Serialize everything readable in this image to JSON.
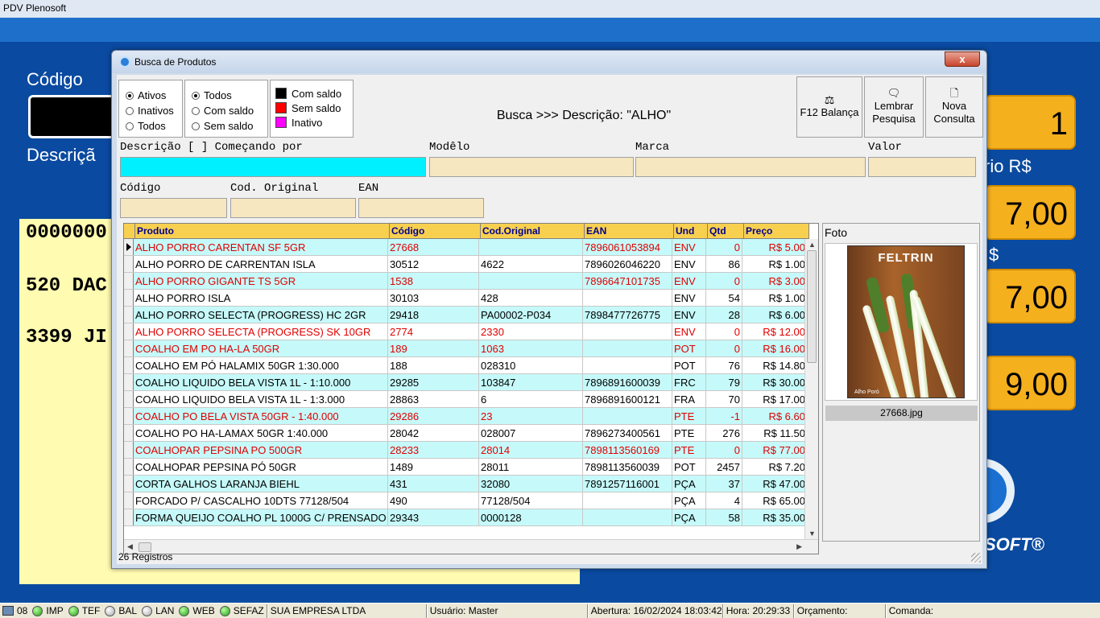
{
  "app": {
    "title": "PDV Plenosoft",
    "bg_codigo_label": "Código",
    "bg_descricao_label": "Descriçã",
    "bg_lines": [
      "0000000",
      "520 DAC",
      "3399 JI"
    ],
    "bg_qty": "1",
    "bg_unit_label": "rio R$",
    "bg_value1": "7,00",
    "bg_currency": "$",
    "bg_value2": "7,00",
    "bg_total": "9,00",
    "bg_logo_text": "SOFT®"
  },
  "dialog": {
    "title": "Busca de Produtos",
    "close_label": "x",
    "status_group": [
      "Ativos",
      "Inativos",
      "Todos"
    ],
    "status_selected": 0,
    "stock_group": [
      "Todos",
      "Com saldo",
      "Sem saldo"
    ],
    "stock_selected": 0,
    "legend": [
      {
        "label": "Com saldo",
        "color": "#000000"
      },
      {
        "label": "Sem saldo",
        "color": "#ff0000"
      },
      {
        "label": "Inativo",
        "color": "#ff00ff"
      }
    ],
    "search_caption": "Busca >>> Descrição: \"ALHO\"",
    "buttons": {
      "balanca": "F12 Balança",
      "lembrar_1": "Lembrar",
      "lembrar_2": "Pesquisa",
      "nova_1": "Nova",
      "nova_2": "Consulta"
    },
    "fields": {
      "descricao_label": "Descrição [ ] Começando por",
      "modelo_label": "Modêlo",
      "marca_label": "Marca",
      "valor_label": "Valor",
      "codigo_label": "Código",
      "cod_original_label": "Cod. Original",
      "ean_label": "EAN"
    },
    "grid": {
      "columns": [
        "Produto",
        "Código",
        "Cod.Original",
        "EAN",
        "Und",
        "Qtd",
        "Preço"
      ],
      "rows": [
        {
          "produto": "ALHO PORRO CARENTAN SF 5GR",
          "codigo": "27668",
          "cod_original": "",
          "ean": "7896061053894",
          "und": "ENV",
          "qtd": "0",
          "preco": "R$ 5.00",
          "red": true
        },
        {
          "produto": "ALHO PORRO DE CARRENTAN ISLA",
          "codigo": "30512",
          "cod_original": "4622",
          "ean": "7896026046220",
          "und": "ENV",
          "qtd": "86",
          "preco": "R$ 1.00",
          "red": false
        },
        {
          "produto": "ALHO PORRO GIGANTE TS 5GR",
          "codigo": "1538",
          "cod_original": "",
          "ean": "7896647101735",
          "und": "ENV",
          "qtd": "0",
          "preco": "R$ 3.00",
          "red": true
        },
        {
          "produto": "ALHO PORRO ISLA",
          "codigo": "30103",
          "cod_original": "428",
          "ean": "",
          "und": "ENV",
          "qtd": "54",
          "preco": "R$ 1.00",
          "red": false
        },
        {
          "produto": "ALHO PORRO SELECTA (PROGRESS) HC 2GR",
          "codigo": "29418",
          "cod_original": "PA00002-P034",
          "ean": "7898477726775",
          "und": "ENV",
          "qtd": "28",
          "preco": "R$ 6.00",
          "red": false
        },
        {
          "produto": "ALHO PORRO SELECTA (PROGRESS) SK 10GR",
          "codigo": "2774",
          "cod_original": "2330",
          "ean": "",
          "und": "ENV",
          "qtd": "0",
          "preco": "R$ 12.00",
          "red": true
        },
        {
          "produto": "COALHO EM PO HA-LA 50GR",
          "codigo": "189",
          "cod_original": "1063",
          "ean": "",
          "und": "POT",
          "qtd": "0",
          "preco": "R$ 16.00",
          "red": true
        },
        {
          "produto": "COALHO EM PÓ HALAMIX 50GR 1:30.000",
          "codigo": "188",
          "cod_original": "028310",
          "ean": "",
          "und": "POT",
          "qtd": "76",
          "preco": "R$ 14.80",
          "red": false
        },
        {
          "produto": "COALHO LIQUIDO BELA VISTA 1L - 1:10.000",
          "codigo": "29285",
          "cod_original": "103847",
          "ean": "7896891600039",
          "und": "FRC",
          "qtd": "79",
          "preco": "R$ 30.00",
          "red": false
        },
        {
          "produto": "COALHO LIQUIDO BELA VISTA 1L - 1:3.000",
          "codigo": "28863",
          "cod_original": "6",
          "ean": "7896891600121",
          "und": "FRA",
          "qtd": "70",
          "preco": "R$ 17.00",
          "red": false
        },
        {
          "produto": "COALHO PO BELA VISTA 50GR - 1:40.000",
          "codigo": "29286",
          "cod_original": "23",
          "ean": "",
          "und": "PTE",
          "qtd": "-1",
          "preco": "R$ 6.60",
          "red": true
        },
        {
          "produto": "COALHO PO HA-LAMAX 50GR 1:40.000",
          "codigo": "28042",
          "cod_original": "028007",
          "ean": "7896273400561",
          "und": "PTE",
          "qtd": "276",
          "preco": "R$ 11.50",
          "red": false
        },
        {
          "produto": "COALHOPAR PEPSINA PO 500GR",
          "codigo": "28233",
          "cod_original": "28014",
          "ean": "7898113560169",
          "und": "PTE",
          "qtd": "0",
          "preco": "R$ 77.00",
          "red": true
        },
        {
          "produto": "COALHOPAR PEPSINA PÓ 50GR",
          "codigo": "1489",
          "cod_original": "28011",
          "ean": "7898113560039",
          "und": "POT",
          "qtd": "2457",
          "preco": "R$ 7.20",
          "red": false
        },
        {
          "produto": "CORTA GALHOS LARANJA BIEHL",
          "codigo": "431",
          "cod_original": "32080",
          "ean": "7891257116001",
          "und": "PÇA",
          "qtd": "37",
          "preco": "R$ 47.00",
          "red": false
        },
        {
          "produto": "FORCADO P/ CASCALHO 10DTS 77128/504",
          "codigo": "490",
          "cod_original": "77128/504",
          "ean": "",
          "und": "PÇA",
          "qtd": "4",
          "preco": "R$ 65.00",
          "red": false
        },
        {
          "produto": "FORMA QUEIJO COALHO PL 1000G C/ PRENSADO",
          "codigo": "29343",
          "cod_original": "0000128",
          "ean": "",
          "und": "PÇA",
          "qtd": "58",
          "preco": "R$ 35.00",
          "red": false
        }
      ]
    },
    "photo": {
      "label": "Foto",
      "brand": "FELTRIN",
      "product_name": "Alho Poró",
      "caption": "27668.jpg"
    },
    "records": "26 Registros"
  },
  "statusbar": {
    "terminal": "08",
    "indicators": [
      {
        "label": "IMP",
        "state": "green"
      },
      {
        "label": "TEF",
        "state": "green"
      },
      {
        "label": "BAL",
        "state": "gray"
      },
      {
        "label": "LAN",
        "state": "gray"
      },
      {
        "label": "WEB",
        "state": "green"
      },
      {
        "label": "SEFAZ",
        "state": "green"
      }
    ],
    "company": "SUA EMPRESA LTDA",
    "usuario": "Usuário: Master",
    "abertura": "Abertura: 16/02/2024 18:03:42",
    "hora": "Hora: 20:29:33",
    "orcamento": "Orçamento:",
    "comanda": "Comanda:"
  }
}
